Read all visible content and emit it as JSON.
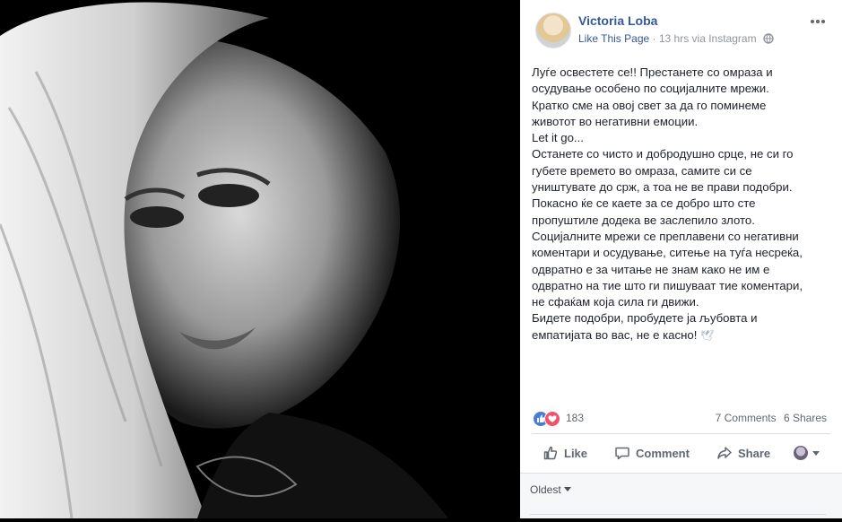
{
  "post": {
    "author": "Victoria Loba",
    "like_page": "Like This Page",
    "separator": "·",
    "time": "13 hrs via Instagram",
    "text_lines": [
      "Луѓе освестете се!! Престанете со омраза и",
      "осудување особено по социјалните мрежи.",
      "Кратко сме на овој свет за да го поминеме",
      "животот во негативни емоции.",
      "Let it go...",
      "Останете со чисто и добродушно срце, не си го",
      "губете времето во омраза, самите си се",
      "уништувате до срж, а тоа не ве прави подобри.",
      "Покасно ќе се каете за се добро што сте",
      "пропуштиле додека ве заслепило злото.",
      "Социјалните мрежи се преплавени со негативни",
      "коментари и осудување, ситење на туѓа несреќа,",
      "одвратно е за читање не знам како не им е",
      "одвратно на тие што ги пишуваат тие коментари,",
      "не сфаќам која сила ги движи.",
      "Бидете подобри, пробудете ја љубовта и",
      "емпатијата во вас, не е касно!"
    ],
    "dove_emoji": "🕊"
  },
  "stats": {
    "reactions": "183",
    "comments": "7 Comments",
    "shares": "6 Shares"
  },
  "actions": {
    "like": "Like",
    "comment": "Comment",
    "share": "Share"
  },
  "comments": {
    "sort_label": "Oldest"
  },
  "colors": {
    "link": "#365899",
    "muted": "#90949c",
    "like_blue": "#4a7bd9",
    "love_red": "#f25268"
  },
  "icons": {
    "more": "more-options-icon",
    "globe": "globe-icon",
    "like": "thumbs-up-icon",
    "comment": "comment-bubble-icon",
    "share": "share-arrow-icon"
  }
}
